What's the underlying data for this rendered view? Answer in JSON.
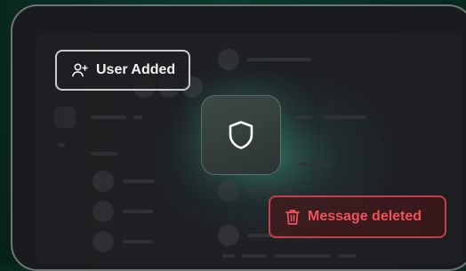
{
  "toasts": {
    "user_added": {
      "label": "User Added",
      "icon": "user-plus-icon"
    },
    "message_deleted": {
      "label": "Message deleted",
      "icon": "trash-icon"
    }
  },
  "center": {
    "icon": "shield-icon"
  },
  "colors": {
    "background": "#0a2b22",
    "frame": "#1a1b1e",
    "success_border": "#c9cdcb",
    "danger": "#f0525a"
  }
}
